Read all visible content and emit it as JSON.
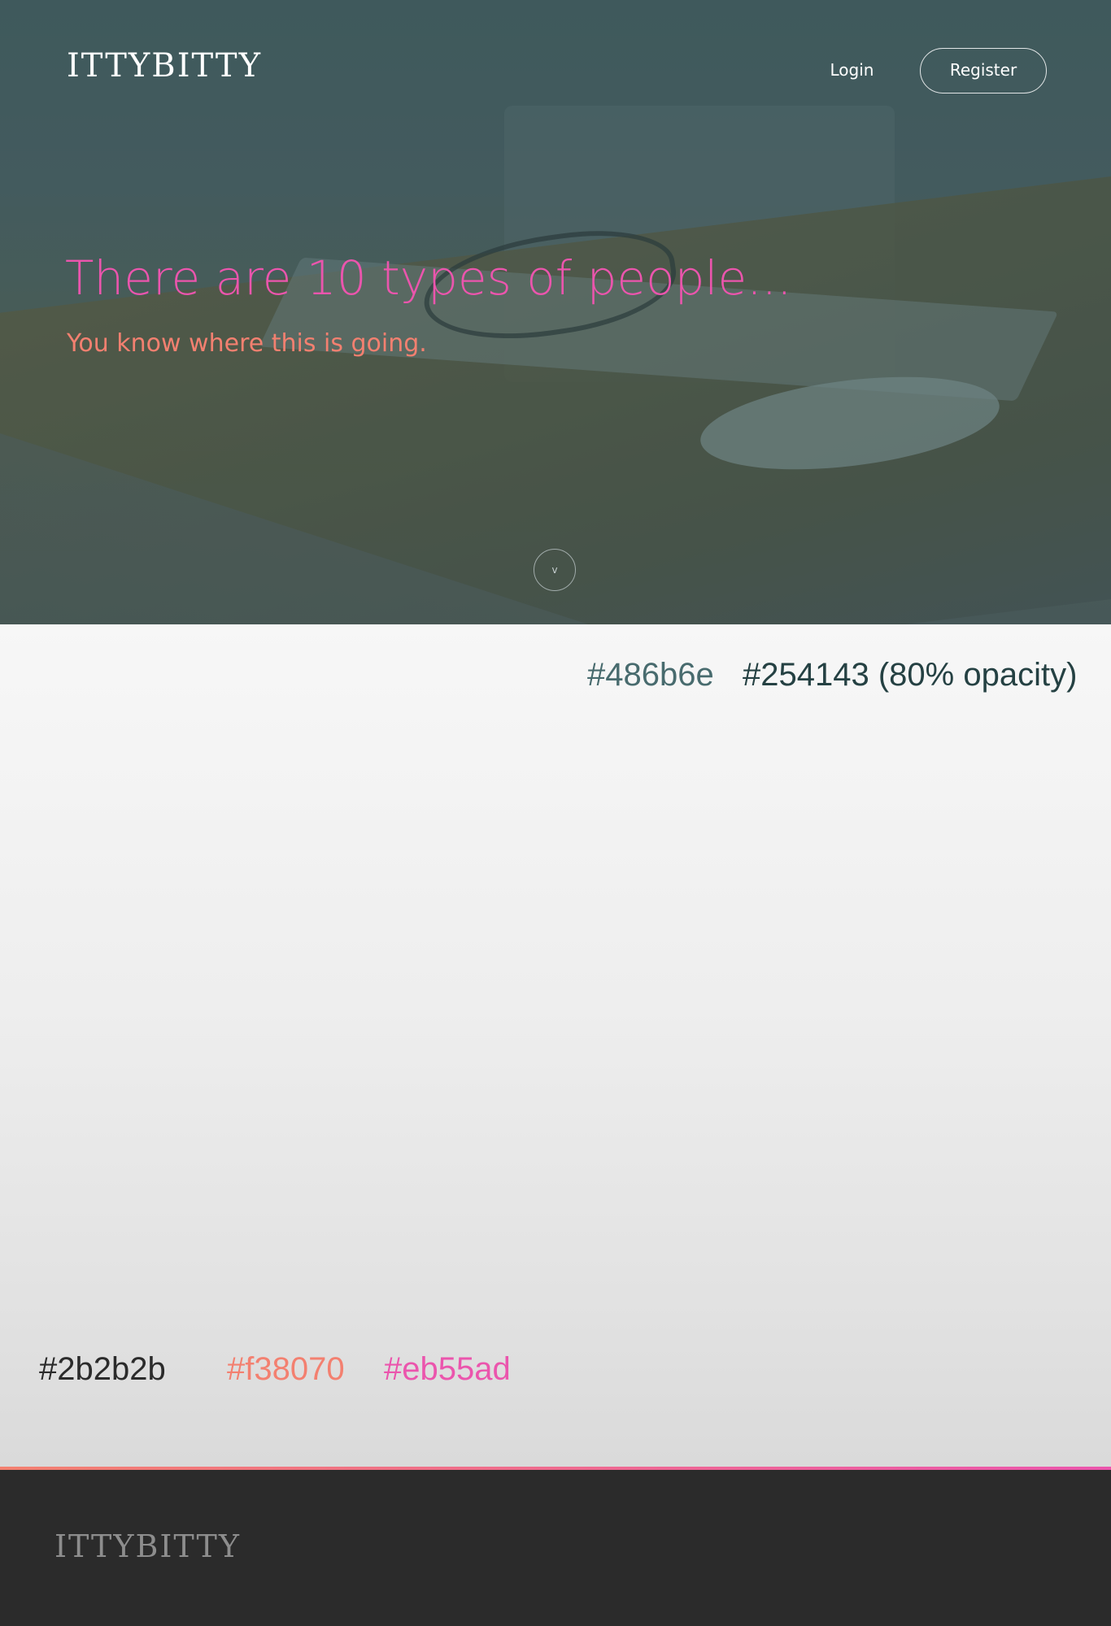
{
  "header": {
    "brand": "ITTYBITTY",
    "nav": {
      "login_label": "Login",
      "register_label": "Register"
    }
  },
  "hero": {
    "headline": "There are 10 types of people...",
    "subheadline": "You know where this is going.",
    "scroll_icon": "chevron-down-icon",
    "scroll_glyph": "v"
  },
  "swatches": {
    "top": [
      {
        "label": "#486b6e",
        "color": "#486b6e"
      },
      {
        "label": "#254143 (80% opacity)",
        "color": "#254143"
      }
    ],
    "bottom": [
      {
        "label": "#2b2b2b",
        "color": "#2b2b2b"
      },
      {
        "label": "#f38070",
        "color": "#f38070"
      },
      {
        "label": "#eb55ad",
        "color": "#eb55ad"
      }
    ]
  },
  "footer": {
    "brand": "ITTYBITTY"
  },
  "colors": {
    "primary": "#486b6e",
    "overlay": "#254143",
    "dark": "#2b2b2b",
    "coral": "#f38070",
    "pink": "#eb55ad"
  }
}
